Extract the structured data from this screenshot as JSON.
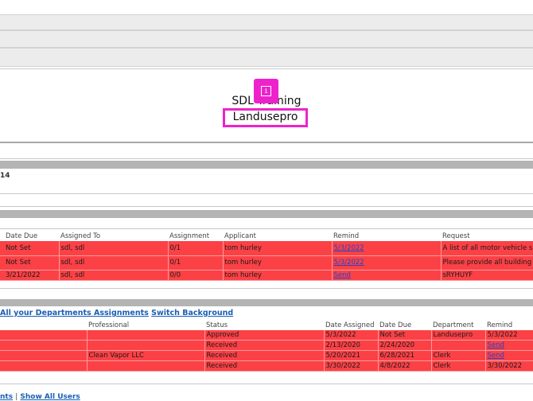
{
  "header": {
    "org_title": "SDL Training",
    "org_name": "Landusepro"
  },
  "info_icon": "info-icon",
  "section_count": "14",
  "requests": {
    "columns": [
      "Date Due",
      "Assigned To",
      "Assignment",
      "Applicant",
      "Remind",
      "Request"
    ],
    "rows": [
      [
        "Not Set",
        "sdl, sdl",
        "0/1",
        "tom hurley",
        "5/3/2022",
        "A list of all motor vehicle sum"
      ],
      [
        "Not Set",
        "sdl, sdl",
        "0/1",
        "tom hurley",
        "5/3/2022",
        "Please provide all building ar"
      ],
      [
        "3/21/2022",
        "sdl, sdl",
        "0/0",
        "tom hurley",
        "Send",
        "sRYHUYF"
      ]
    ]
  },
  "subnav": {
    "all_assignments": "All your Departments Assignments",
    "switch_background": "Switch Background"
  },
  "assignments": {
    "columns": [
      "",
      "Professional",
      "Status",
      "Date Assigned",
      "Date Due",
      "Department",
      "Remind"
    ],
    "rows": [
      [
        "",
        "",
        "Approved",
        "5/3/2022",
        "Not Set",
        "Landusepro",
        "5/3/2022"
      ],
      [
        "",
        "",
        "Received",
        "2/13/2020",
        "2/24/2020",
        "",
        "Send"
      ],
      [
        "",
        "Clean Vapor LLC",
        "Received",
        "5/20/2021",
        "6/28/2021",
        "Clerk",
        "Send"
      ],
      [
        "",
        "",
        "Received",
        "3/30/2022",
        "4/8/2022",
        "Clerk",
        "3/30/2022"
      ]
    ]
  },
  "footer": {
    "link1": "nts",
    "separator": "|",
    "link2": "Show All Users"
  }
}
